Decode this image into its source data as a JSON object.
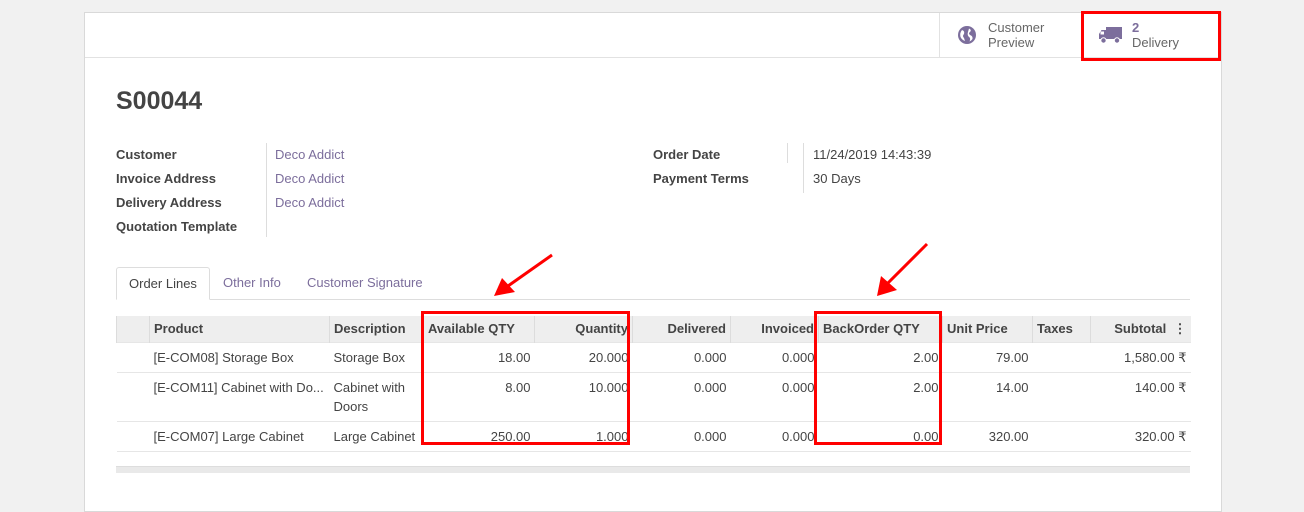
{
  "buttons": {
    "preview": {
      "line1": "Customer",
      "line2": "Preview"
    },
    "delivery": {
      "count": "2",
      "label": "Delivery"
    }
  },
  "order": {
    "name": "S00044",
    "fields_left": [
      {
        "label": "Customer",
        "value": "Deco Addict"
      },
      {
        "label": "Invoice Address",
        "value": "Deco Addict"
      },
      {
        "label": "Delivery Address",
        "value": "Deco Addict"
      },
      {
        "label": "Quotation Template",
        "value": ""
      }
    ],
    "fields_right": [
      {
        "label": "Order Date",
        "value": "11/24/2019 14:43:39"
      },
      {
        "label": "Payment Terms",
        "value": "30 Days"
      }
    ]
  },
  "tabs": [
    "Order Lines",
    "Other Info",
    "Customer Signature"
  ],
  "table": {
    "columns": [
      "Product",
      "Description",
      "Available QTY",
      "Quantity",
      "Delivered",
      "Invoiced",
      "BackOrder QTY",
      "Unit Price",
      "Taxes",
      "Subtotal"
    ],
    "rows": [
      {
        "product": "[E-COM08] Storage Box",
        "description": "Storage Box",
        "available": "18.00",
        "quantity": "20.000",
        "delivered": "0.000",
        "invoiced": "0.000",
        "backorder": "2.00",
        "unit_price": "79.00",
        "taxes": "",
        "subtotal": "1,580.00 ₹"
      },
      {
        "product": "[E-COM11] Cabinet with Do...",
        "description": "Cabinet with Doors",
        "available": "8.00",
        "quantity": "10.000",
        "delivered": "0.000",
        "invoiced": "0.000",
        "backorder": "2.00",
        "unit_price": "14.00",
        "taxes": "",
        "subtotal": "140.00 ₹"
      },
      {
        "product": "[E-COM07] Large Cabinet",
        "description": "Large Cabinet",
        "available": "250.00",
        "quantity": "1.000",
        "delivered": "0.000",
        "invoiced": "0.000",
        "backorder": "0.00",
        "unit_price": "320.00",
        "taxes": "",
        "subtotal": "320.00 ₹"
      }
    ]
  },
  "colors": {
    "accent": "#7c6e9c",
    "highlight": "#ff0000"
  }
}
